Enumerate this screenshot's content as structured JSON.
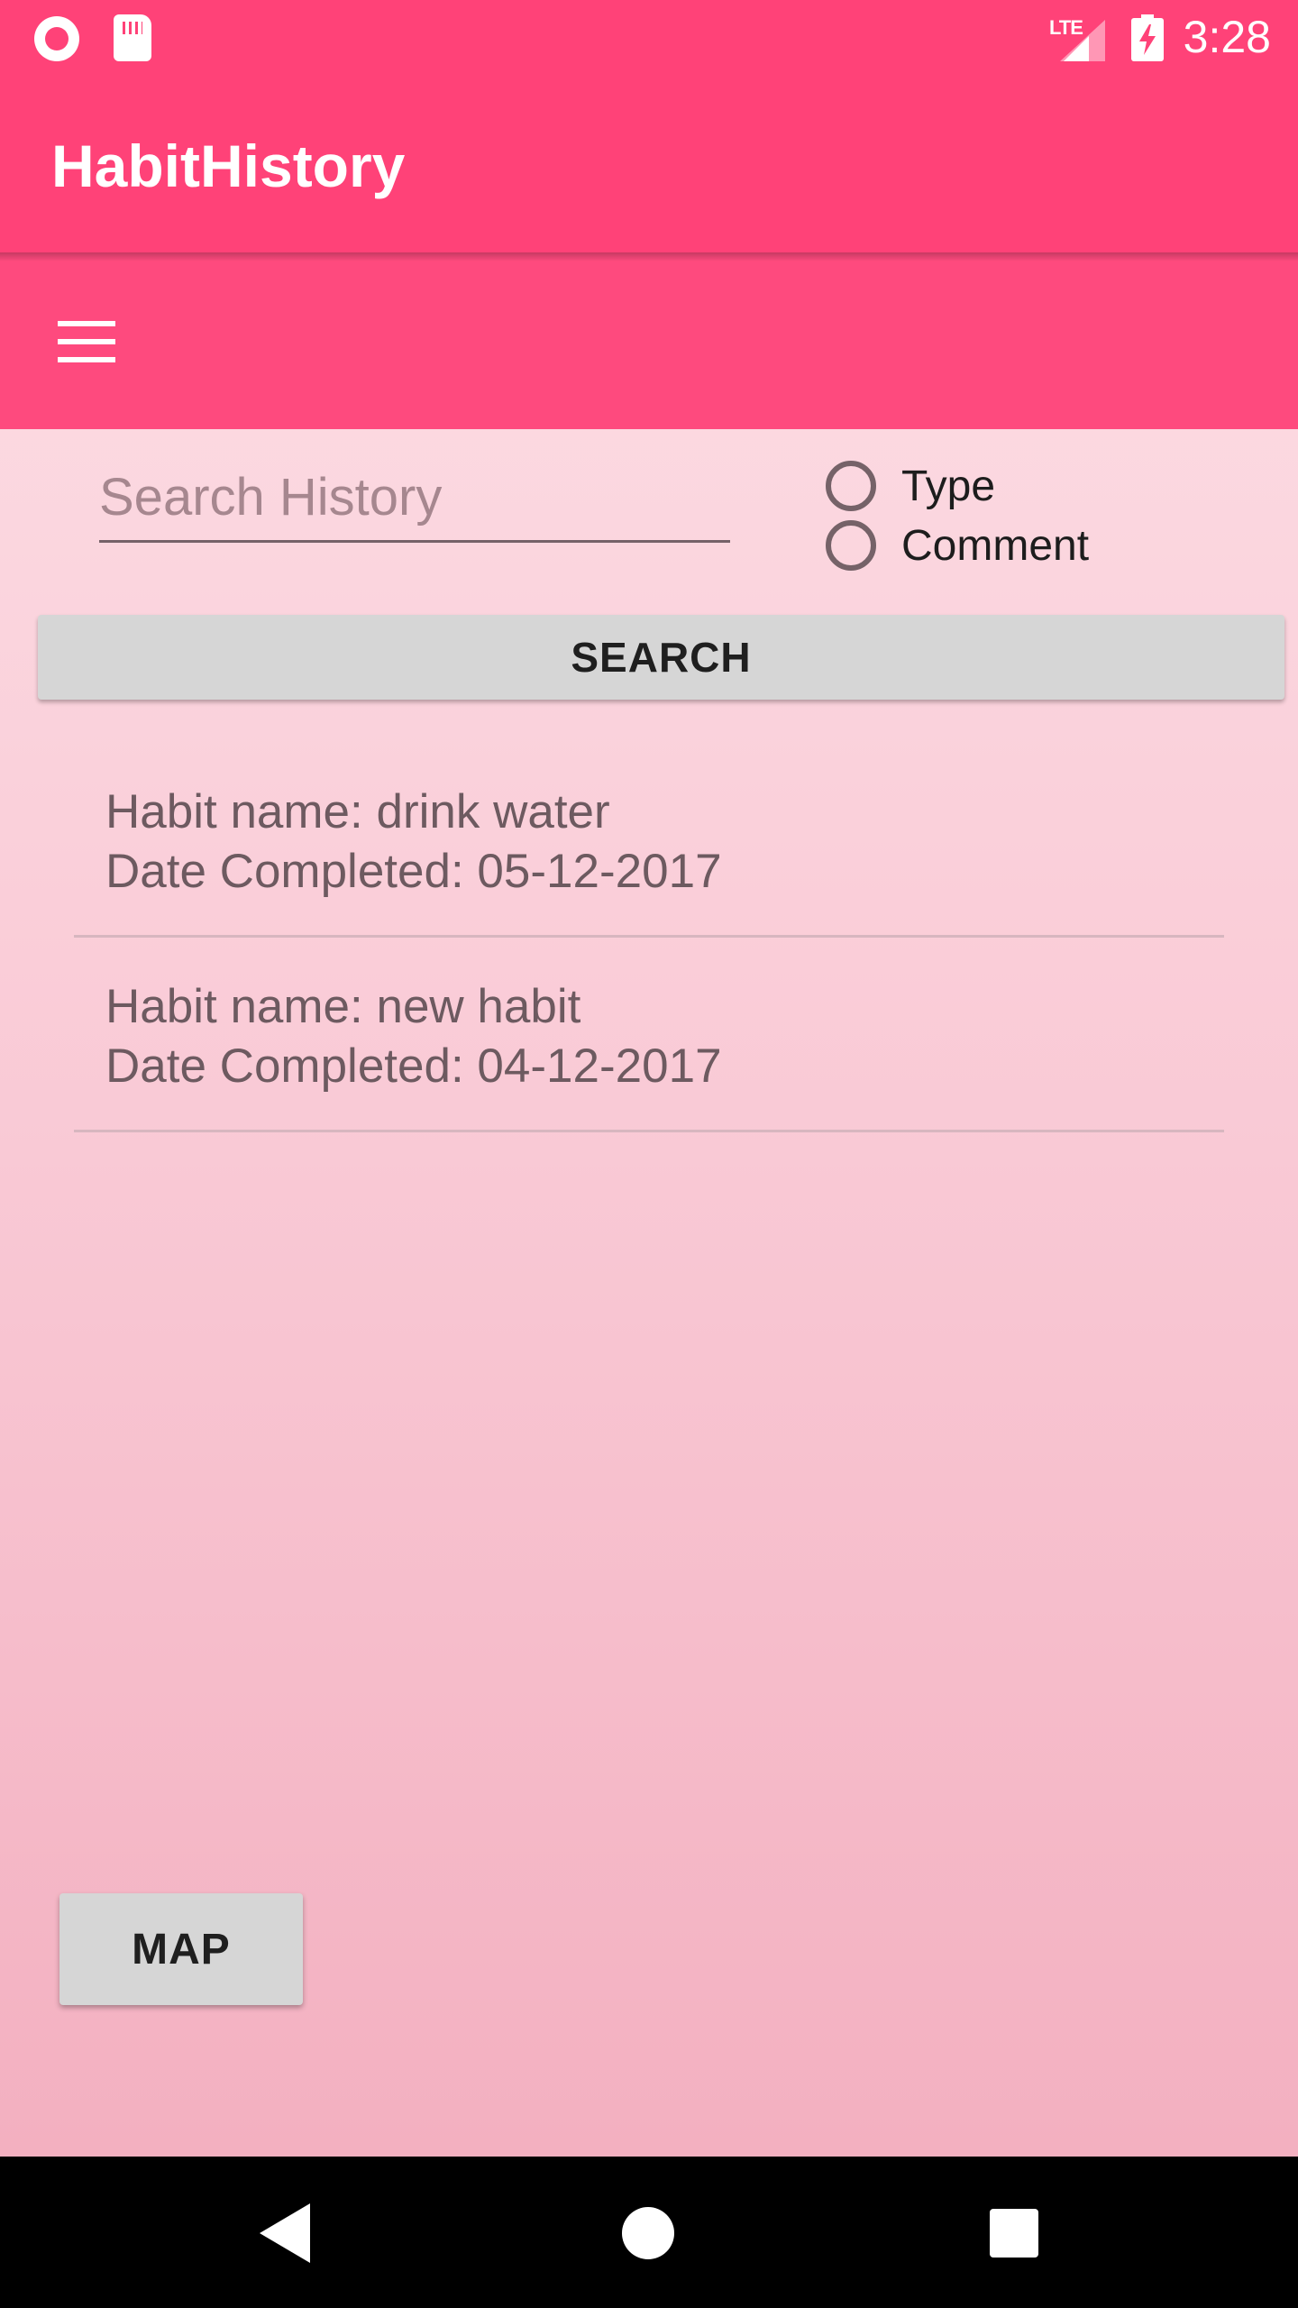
{
  "status_bar": {
    "network": "LTE",
    "time": "3:28",
    "icons": [
      "record-icon",
      "sd-card-icon",
      "signal-icon",
      "battery-charging-icon"
    ]
  },
  "app_bar": {
    "title": "HabitHistory"
  },
  "toolbar": {
    "menu_icon": "hamburger-menu-icon"
  },
  "search": {
    "placeholder": "Search History",
    "value": "",
    "filters": [
      {
        "label": "Type",
        "selected": false
      },
      {
        "label": "Comment",
        "selected": false
      }
    ],
    "button_label": "SEARCH"
  },
  "history": [
    {
      "habit_line": "Habit name: drink water",
      "date_line": "Date Completed: 05-12-2017"
    },
    {
      "habit_line": "Habit name: new habit",
      "date_line": "Date Completed: 04-12-2017"
    }
  ],
  "map_button": {
    "label": "MAP"
  },
  "nav_bar": {
    "icons": [
      "back-icon",
      "home-icon",
      "recents-icon"
    ]
  },
  "colors": {
    "primary": "#ff4278",
    "background_top": "#fde1e7",
    "background_bottom": "#f2acbd",
    "button_gray": "#d6d6d6"
  }
}
